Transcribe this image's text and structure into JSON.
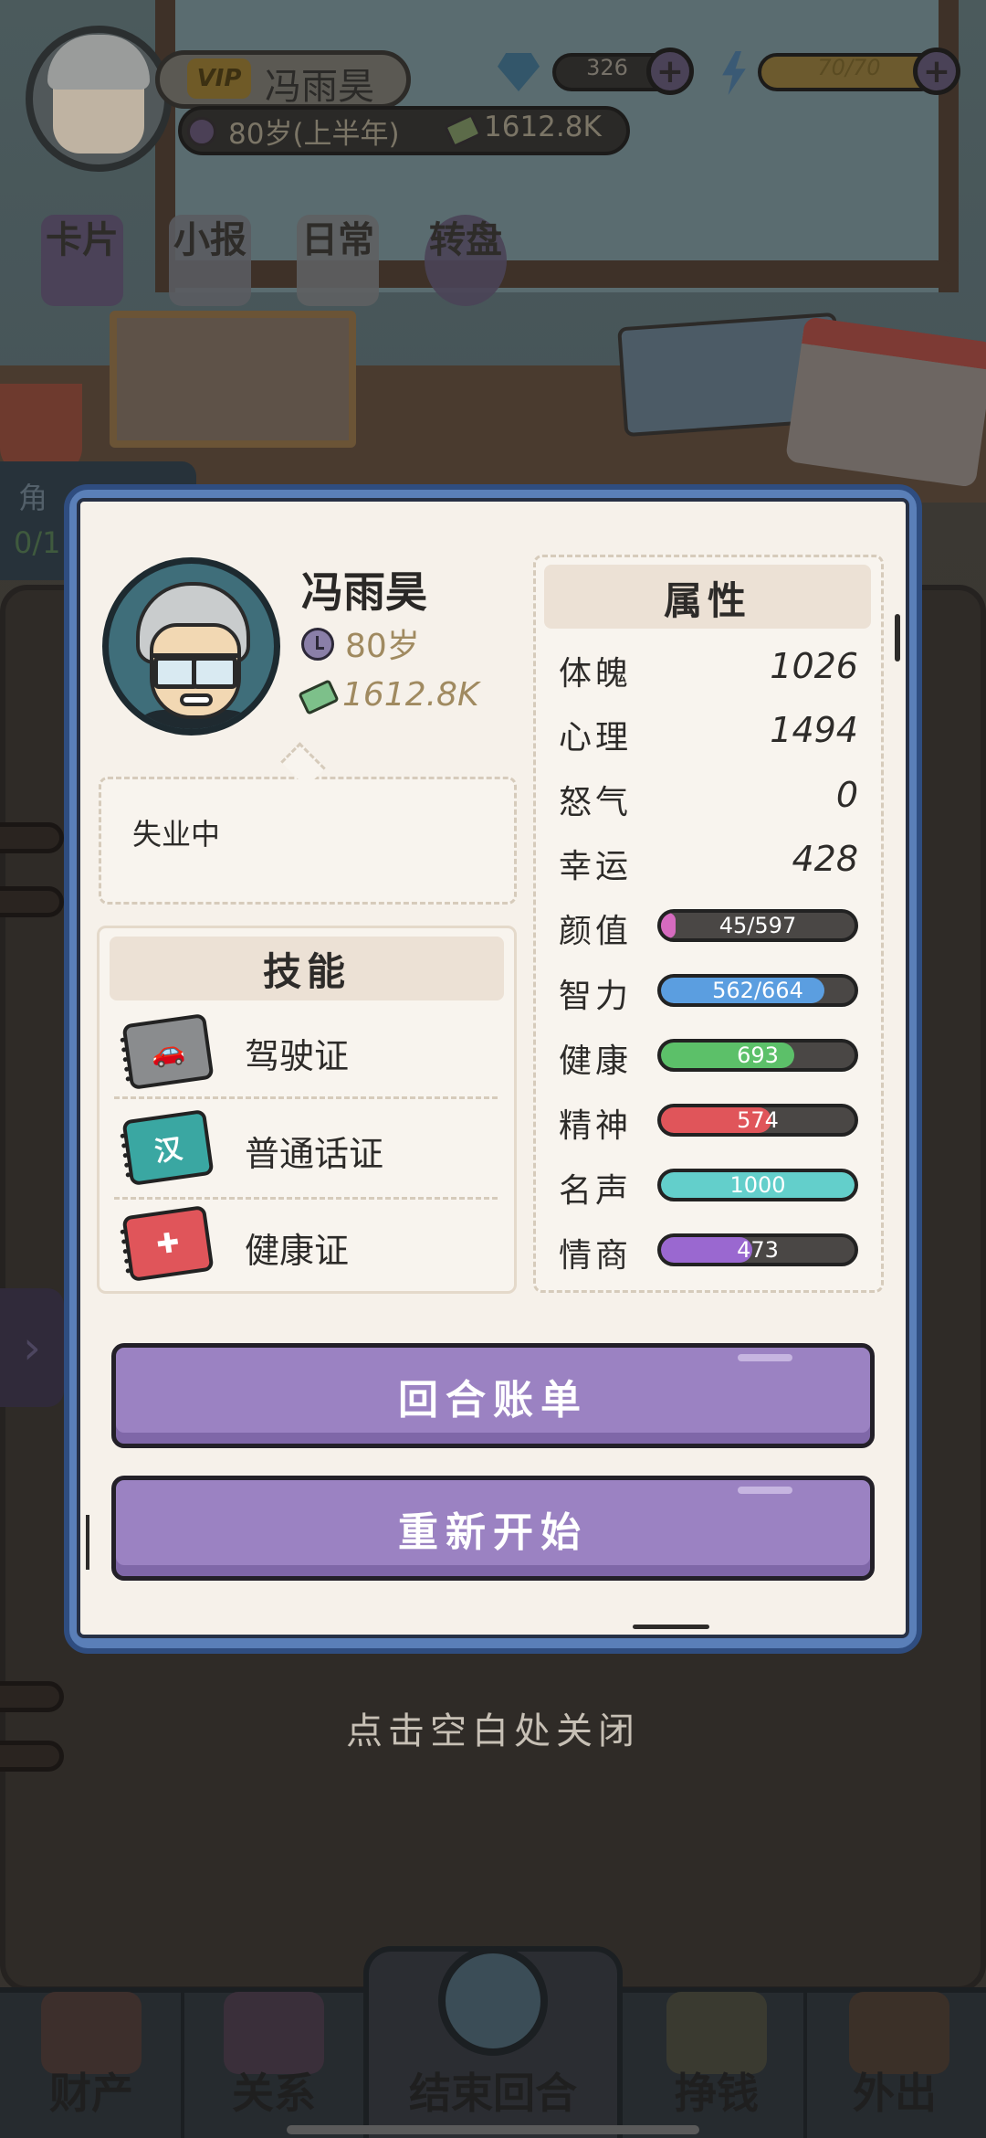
{
  "hud": {
    "vip_label": "VIP",
    "player_name": "冯雨昊",
    "age_text": "80岁(上半年)",
    "money_text": "1612.8K",
    "gem_count": "326",
    "energy_count": "70/70",
    "plus_label": "+",
    "menu": [
      {
        "label": "卡片",
        "icon": "cards-icon"
      },
      {
        "label": "小报",
        "icon": "newspaper-icon"
      },
      {
        "label": "日常",
        "icon": "checklist-icon"
      },
      {
        "label": "转盘",
        "icon": "wheel-icon"
      }
    ],
    "side_tab_text": "角",
    "side_tab_num": "0/1"
  },
  "profile": {
    "name": "冯雨昊",
    "age": "80岁",
    "money": "1612.8K",
    "status": "失业中"
  },
  "skills": {
    "title": "技能",
    "items": [
      {
        "label": "驾驶证",
        "icon": "car-license-icon",
        "color": "#8a8c8e",
        "glyph": "🚗"
      },
      {
        "label": "普通话证",
        "icon": "mandarin-cert-icon",
        "color": "#3aa7a2",
        "glyph": "汉"
      },
      {
        "label": "健康证",
        "icon": "health-cert-icon",
        "color": "#e0555a",
        "glyph": "✚"
      }
    ]
  },
  "attributes": {
    "title": "属性",
    "plain": [
      {
        "name": "体魄",
        "value": "1026"
      },
      {
        "name": "心理",
        "value": "1494"
      },
      {
        "name": "怒气",
        "value": "0"
      },
      {
        "name": "幸运",
        "value": "428"
      }
    ],
    "bars": [
      {
        "name": "颜值",
        "text": "45/597",
        "fraction": 0.075,
        "color": "#d66bbf"
      },
      {
        "name": "智力",
        "text": "562/664",
        "fraction": 0.846,
        "color": "#5b9ee0"
      },
      {
        "name": "健康",
        "text": "693",
        "fraction": 0.69,
        "color": "#5cc069"
      },
      {
        "name": "精神",
        "text": "574",
        "fraction": 0.57,
        "color": "#e0555a"
      },
      {
        "name": "名声",
        "text": "1000",
        "fraction": 1.0,
        "color": "#63cfcb"
      },
      {
        "name": "情商",
        "text": "473",
        "fraction": 0.47,
        "color": "#9a68d0"
      }
    ]
  },
  "buttons": {
    "bill": "回合账单",
    "restart": "重新开始"
  },
  "close_hint": "点击空白处关闭",
  "bottom_nav": [
    {
      "label": "财产",
      "icon": "house-icon"
    },
    {
      "label": "关系",
      "icon": "contacts-icon"
    },
    {
      "label": "结束回合",
      "icon": "alarm-clock-icon"
    },
    {
      "label": "挣钱",
      "icon": "fist-icon"
    },
    {
      "label": "外出",
      "icon": "door-icon"
    }
  ]
}
